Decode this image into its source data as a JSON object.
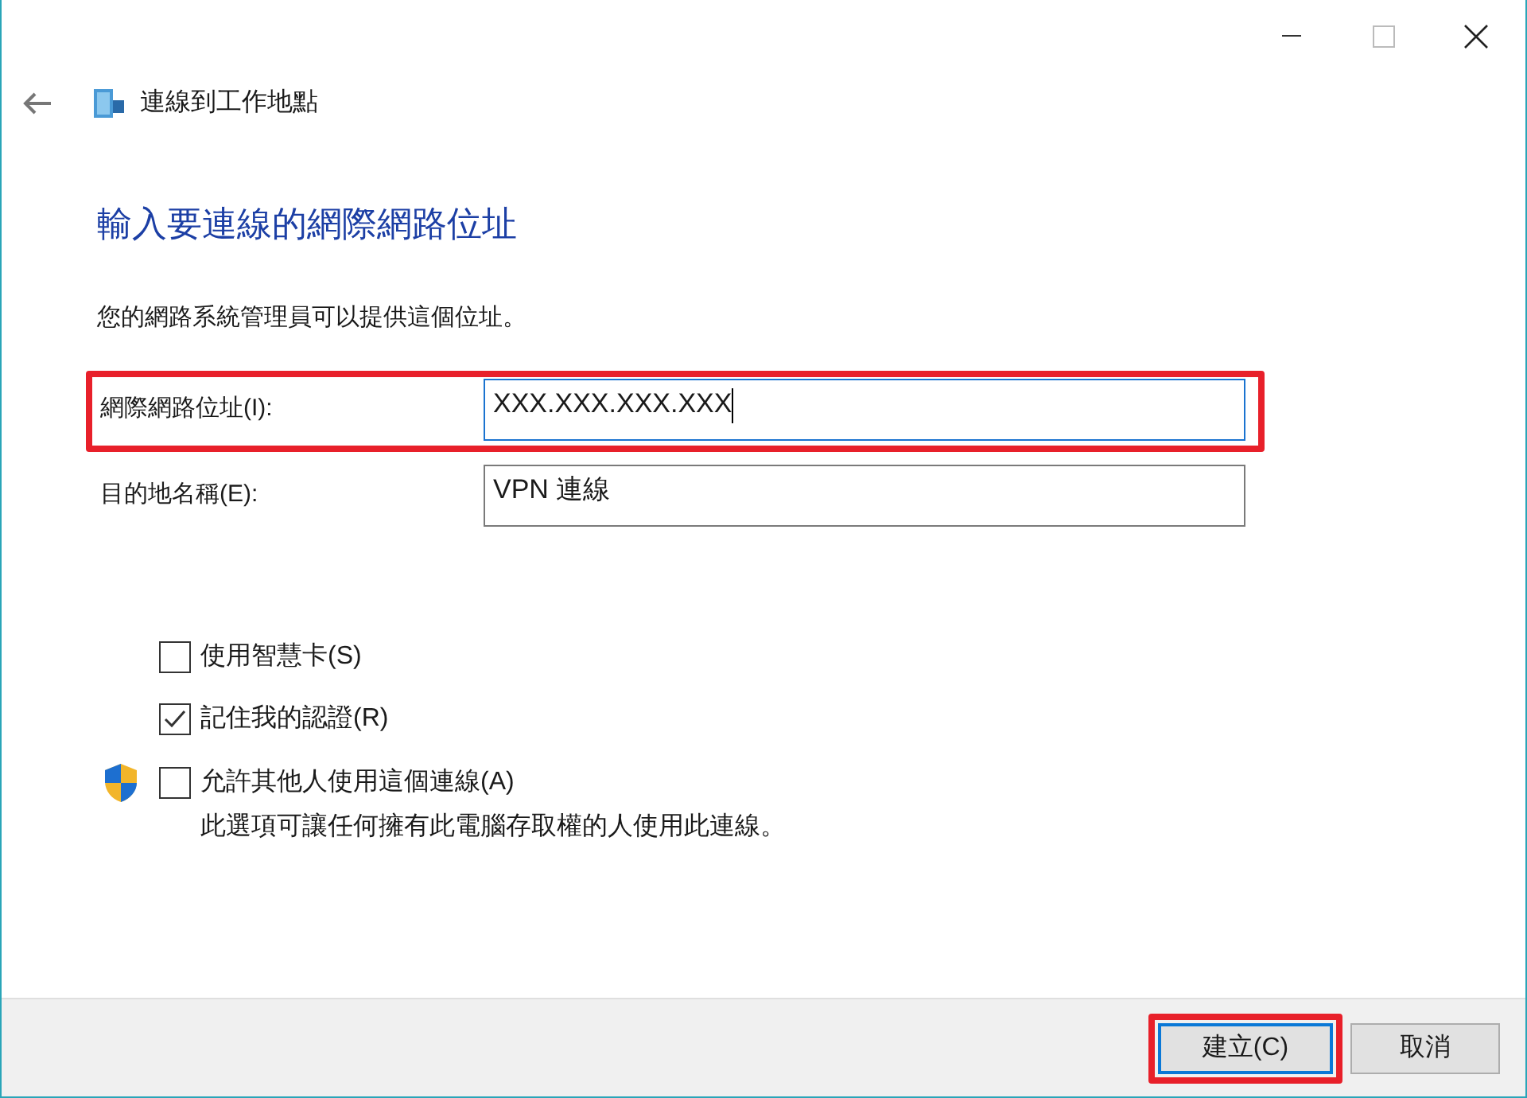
{
  "window": {
    "title": "連線到工作地點"
  },
  "heading": "輸入要連線的網際網路位址",
  "description": "您的網路系統管理員可以提供這個位址。",
  "fields": [
    {
      "label": "網際網路位址(I):",
      "value": "XXX.XXX.XXX.XXX",
      "focused": true,
      "highlighted": true
    },
    {
      "label": "目的地名稱(E):",
      "value": "VPN 連線",
      "focused": false,
      "highlighted": false
    }
  ],
  "options": [
    {
      "label": "使用智慧卡(S)",
      "checked": false,
      "shield": false
    },
    {
      "label": "記住我的認證(R)",
      "checked": true,
      "shield": false
    },
    {
      "label": "允許其他人使用這個連線(A)",
      "checked": false,
      "shield": true,
      "note": "此選項可讓任何擁有此電腦存取權的人使用此連線。"
    }
  ],
  "buttons": [
    {
      "label": "建立(C)",
      "default": true,
      "highlighted": true
    },
    {
      "label": "取消",
      "default": false,
      "highlighted": false
    }
  ]
}
